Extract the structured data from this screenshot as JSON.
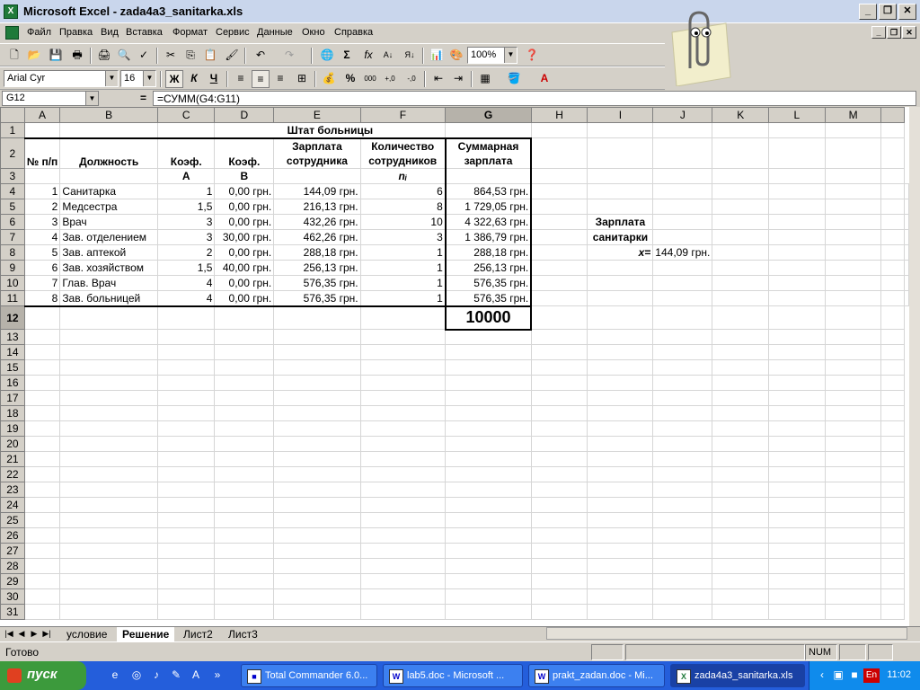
{
  "title": "Microsoft Excel - zada4a3_sanitarka.xls",
  "menu": [
    "Файл",
    "Правка",
    "Вид",
    "Вставка",
    "Формат",
    "Сервис",
    "Данные",
    "Окно",
    "Справка"
  ],
  "toolbar": {
    "zoom": "100%",
    "font": "Arial Cyr",
    "size": "16",
    "bold": "Ж",
    "italic": "К",
    "underline": "Ч"
  },
  "formula": {
    "cell": "G12",
    "eq": "=",
    "content": "=СУММ(G4:G11)"
  },
  "columns": [
    "A",
    "B",
    "C",
    "D",
    "E",
    "F",
    "G",
    "H",
    "I",
    "J",
    "K",
    "L",
    "M"
  ],
  "rows": [
    "1",
    "2",
    "3",
    "4",
    "5",
    "6",
    "7",
    "8",
    "9",
    "10",
    "11",
    "12",
    "13",
    "14",
    "15",
    "16",
    "17",
    "18",
    "19",
    "20",
    "21",
    "22",
    "23",
    "24",
    "25",
    "26",
    "27",
    "28",
    "29",
    "30",
    "31"
  ],
  "sheet": {
    "title": "Штат больницы",
    "h_num": "№ п/п",
    "h_pos": "Должность",
    "h_ka": "Коэф.",
    "h_kb": "Коэф.",
    "h_sal": "Зарплата сотрудника",
    "h_cnt": "Количество сотрудников",
    "h_sum": "Суммарная зарплата",
    "h_a": "A",
    "h_b": "B",
    "h_ni": "nᵢ",
    "data": [
      {
        "n": "1",
        "pos": "Санитарка",
        "a": "1",
        "b": "0,00 грн.",
        "sal": "144,09 грн.",
        "cnt": "6",
        "sum": "864,53 грн."
      },
      {
        "n": "2",
        "pos": "Медсестра",
        "a": "1,5",
        "b": "0,00 грн.",
        "sal": "216,13 грн.",
        "cnt": "8",
        "sum": "1 729,05 грн."
      },
      {
        "n": "3",
        "pos": "Врач",
        "a": "3",
        "b": "0,00 грн.",
        "sal": "432,26 грн.",
        "cnt": "10",
        "sum": "4 322,63 грн."
      },
      {
        "n": "4",
        "pos": "Зав. отделением",
        "a": "3",
        "b": "30,00 грн.",
        "sal": "462,26 грн.",
        "cnt": "3",
        "sum": "1 386,79 грн."
      },
      {
        "n": "5",
        "pos": "Зав. аптекой",
        "a": "2",
        "b": "0,00 грн.",
        "sal": "288,18 грн.",
        "cnt": "1",
        "sum": "288,18 грн."
      },
      {
        "n": "6",
        "pos": "Зав. хозяйством",
        "a": "1,5",
        "b": "40,00 грн.",
        "sal": "256,13 грн.",
        "cnt": "1",
        "sum": "256,13 грн."
      },
      {
        "n": "7",
        "pos": "Глав. Врач",
        "a": "4",
        "b": "0,00 грн.",
        "sal": "576,35 грн.",
        "cnt": "1",
        "sum": "576,35 грн."
      },
      {
        "n": "8",
        "pos": "Зав. больницей",
        "a": "4",
        "b": "0,00 грн.",
        "sal": "576,35 грн.",
        "cnt": "1",
        "sum": "576,35 грн."
      }
    ],
    "total": "10000",
    "side_label1": "Зарплата",
    "side_label2": "санитарки",
    "side_x": "x=",
    "side_val": "144,09 грн."
  },
  "tabs": [
    "условие",
    "Решение",
    "Лист2",
    "Лист3"
  ],
  "status": {
    "ready": "Готово",
    "num": "NUM"
  },
  "taskbar": {
    "start": "пуск",
    "tasks": [
      "Total Commander 6.0...",
      "lab5.doc - Microsoft ...",
      "prakt_zadan.doc - Mi...",
      "zada4a3_sanitarka.xls"
    ],
    "lang": "En",
    "clock": "11:02"
  }
}
